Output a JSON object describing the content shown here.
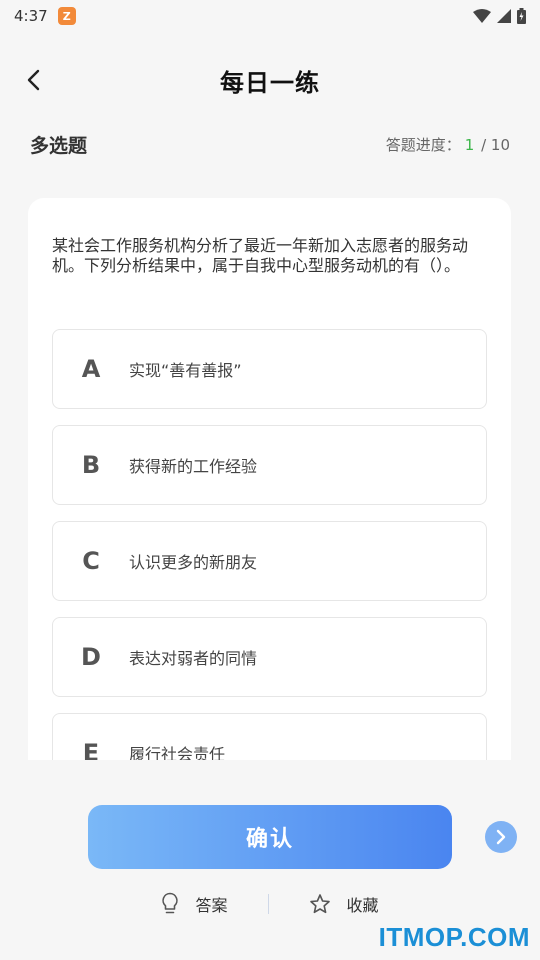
{
  "status_bar": {
    "time": "4:37",
    "app_icon_letter": "Z",
    "icons": [
      "wifi-icon",
      "signal-icon",
      "battery-icon"
    ]
  },
  "header": {
    "title": "每日一练",
    "back_icon": "chevron-left-icon"
  },
  "question_meta": {
    "type": "多选题",
    "progress_label": "答题进度：",
    "progress_current": "1",
    "progress_sep": "/",
    "progress_total": "10"
  },
  "question": {
    "text": "某社会工作服务机构分析了最近一年新加入志愿者的服务动机。下列分析结果中，属于自我中心型服务动机的有（）。",
    "options": [
      {
        "letter": "A",
        "text": "实现“善有善报”"
      },
      {
        "letter": "B",
        "text": "获得新的工作经验"
      },
      {
        "letter": "C",
        "text": "认识更多的新朋友"
      },
      {
        "letter": "D",
        "text": "表达对弱者的同情"
      },
      {
        "letter": "E",
        "text": "履行社会责任"
      }
    ]
  },
  "actions": {
    "confirm_label": "确认",
    "answer_label": "答案",
    "favorite_label": "收藏",
    "next_icon": "chevron-right-icon",
    "answer_icon": "lightbulb-icon",
    "favorite_icon": "star-icon"
  },
  "watermark": "ITMOP.COM",
  "colors": {
    "accent": "#4a85f0",
    "accent_light": "#7ab8f7",
    "progress_current": "#3cb64a",
    "watermark": "#1b8fd6"
  }
}
